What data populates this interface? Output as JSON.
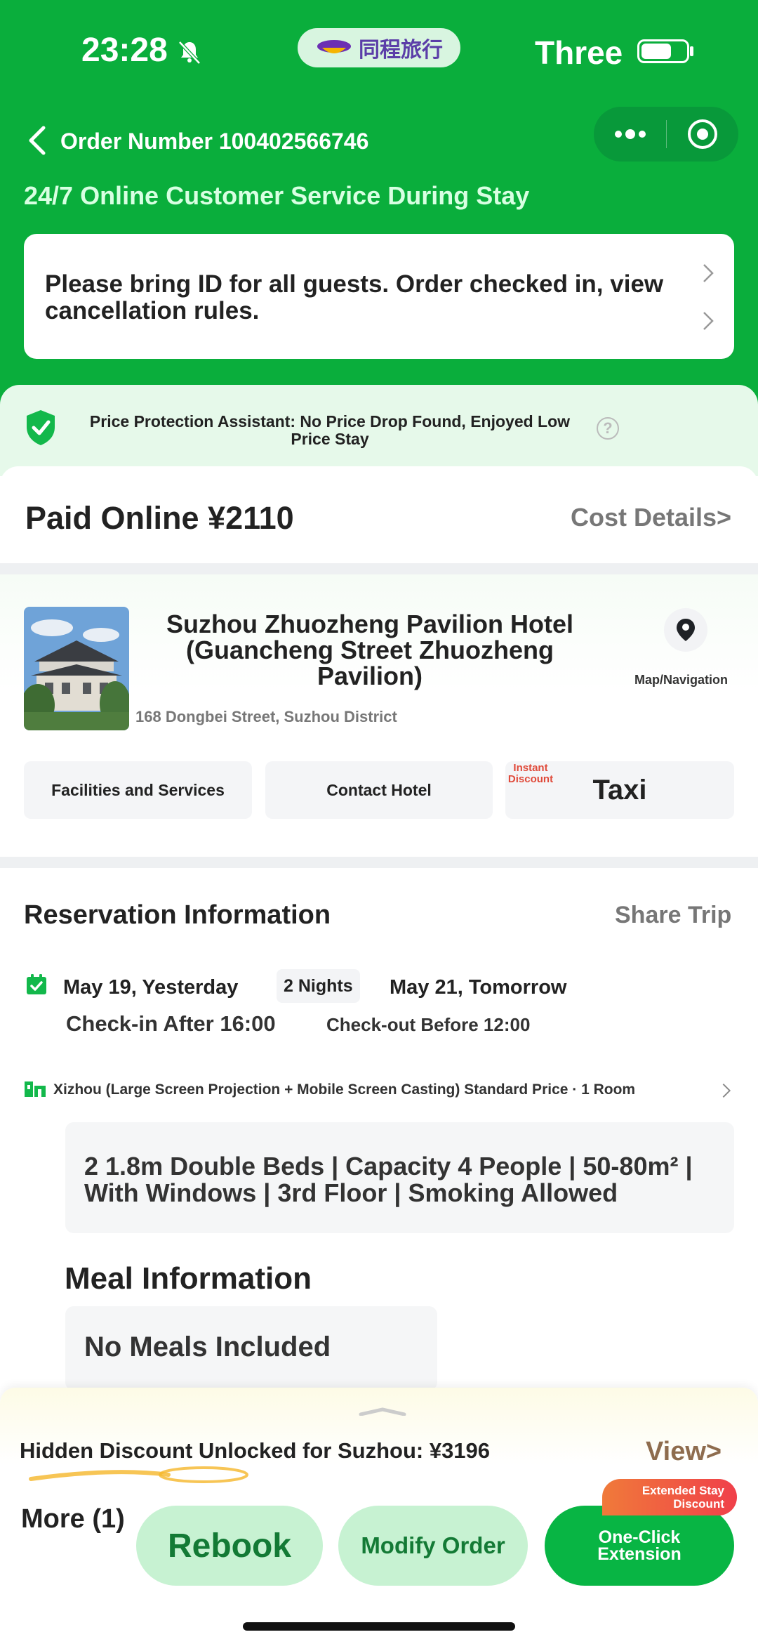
{
  "status_bar": {
    "time": "23:28",
    "brand": "同程旅行",
    "carrier": "Three"
  },
  "nav": {
    "order_number": "Order Number 100402566746",
    "service_text": "24/7 Online Customer Service During Stay"
  },
  "notice": {
    "text": "Please bring ID for all guests. Order checked in, view cancellation rules."
  },
  "price_protection": {
    "text": "Price Protection Assistant: No Price Drop Found, Enjoyed Low Price Stay",
    "help": "?"
  },
  "payment": {
    "paid": "Paid Online ¥2110",
    "cost_details": "Cost Details>"
  },
  "hotel": {
    "name": "Suzhou Zhuozheng Pavilion Hotel (Guancheng Street Zhuozheng Pavilion)",
    "address": "168 Dongbei Street, Suzhou District",
    "map_label": "Map/Navigation",
    "facilities": "Facilities and Services",
    "contact": "Contact Hotel",
    "instant_discount": "Instant Discount",
    "taxi": "Taxi"
  },
  "reservation": {
    "title": "Reservation Information",
    "share": "Share Trip",
    "checkin_date": "May 19, Yesterday",
    "nights": "2 Nights",
    "checkout_date": "May 21, Tomorrow",
    "checkin_time": "Check-in After 16:00",
    "checkout_time": "Check-out Before 12:00",
    "room_type": "Xizhou (Large Screen Projection + Mobile Screen Casting) Standard Price · 1 Room",
    "room_details": "2 1.8m Double Beds | Capacity 4 People | 50-80m² | With Windows | 3rd Floor | Smoking Allowed",
    "meal_title": "Meal Information",
    "meal_value": "No Meals Included"
  },
  "bottom_bar": {
    "discount": "Hidden Discount Unlocked for Suzhou: ¥3196",
    "view": "View>",
    "more": "More (1)",
    "rebook": "Rebook",
    "modify": "Modify Order",
    "extend": "One-Click Extension",
    "extend_badge": "Extended Stay Discount"
  },
  "colors": {
    "brand_green": "#0aae3c",
    "button_green": "#08b544",
    "light_green": "#c7f2d2",
    "discount_red": "#e04a3a"
  }
}
